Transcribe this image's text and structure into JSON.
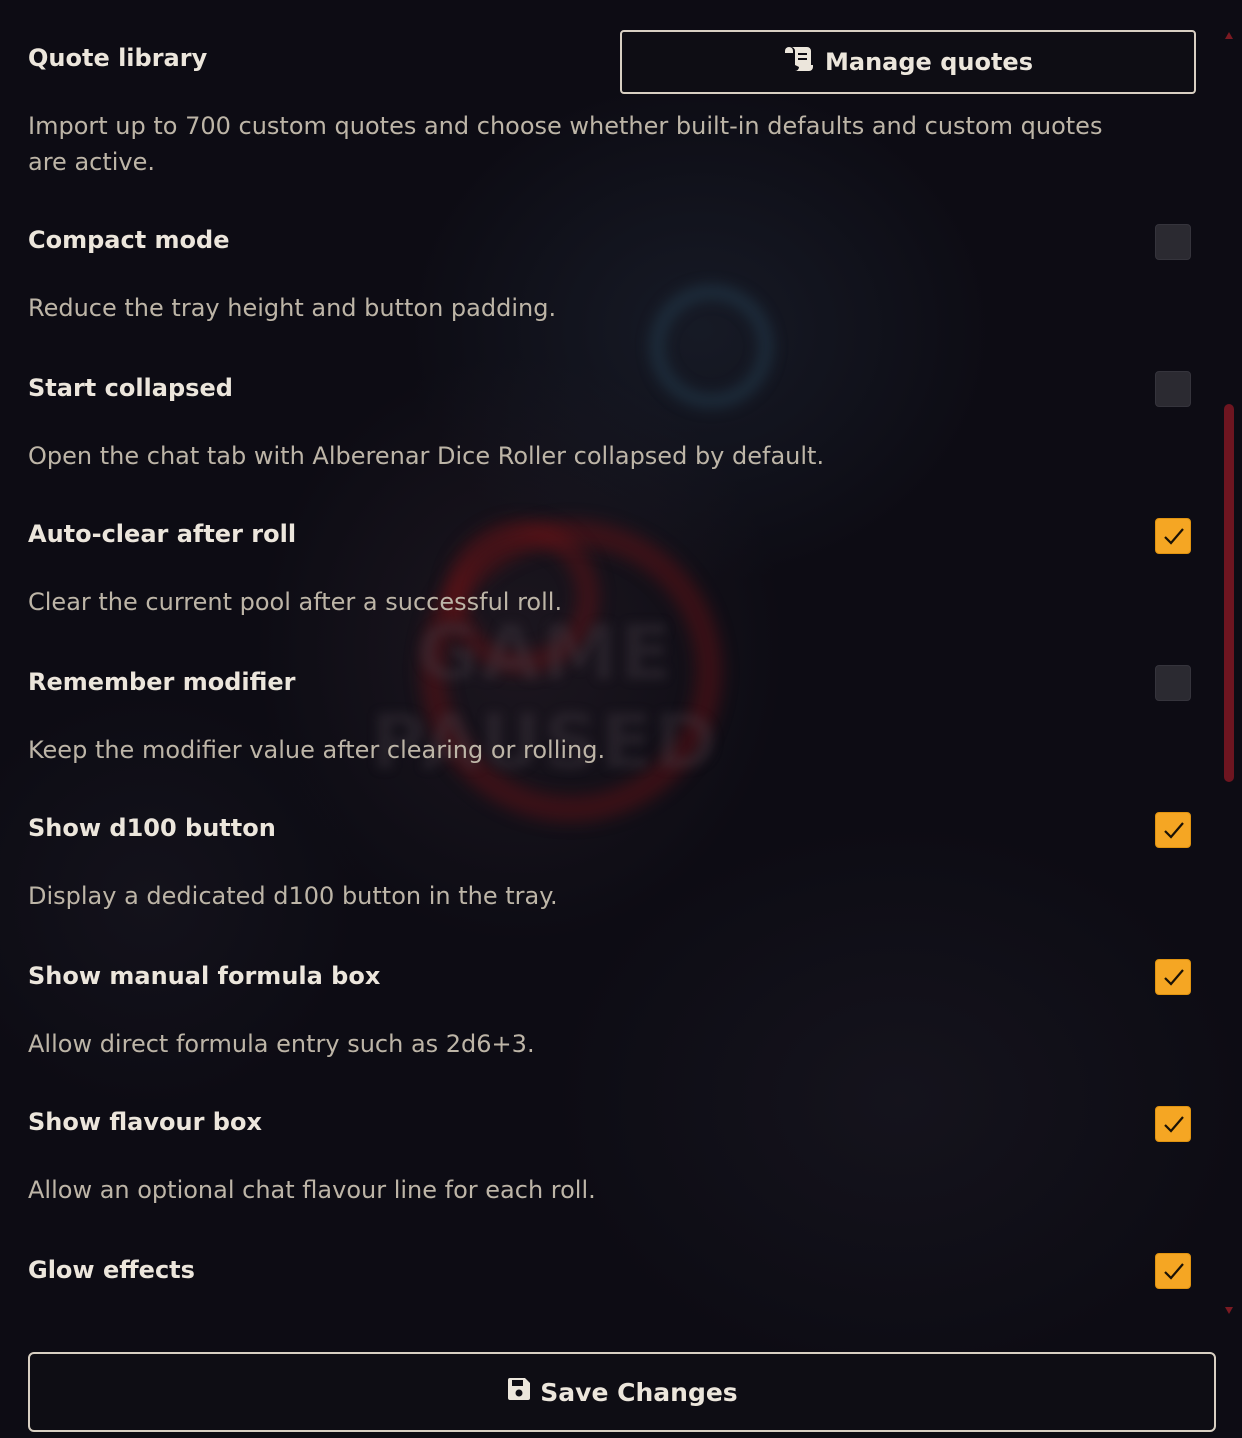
{
  "quote_library": {
    "label": "Quote library",
    "button_label": "Manage quotes",
    "button_icon": "scroll-icon",
    "hint": "Import up to 700 custom quotes and choose whether built-in defaults and custom quotes are active."
  },
  "settings": [
    {
      "label": "Compact mode",
      "hint": "Reduce the tray height and button padding.",
      "checked": false
    },
    {
      "label": "Start collapsed",
      "hint": "Open the chat tab with Alberenar Dice Roller collapsed by default.",
      "checked": false
    },
    {
      "label": "Auto-clear after roll",
      "hint": "Clear the current pool after a successful roll.",
      "checked": true
    },
    {
      "label": "Remember modifier",
      "hint": "Keep the modifier value after clearing or rolling.",
      "checked": false
    },
    {
      "label": "Show d100 button",
      "hint": "Display a dedicated d100 button in the tray.",
      "checked": true
    },
    {
      "label": "Show manual formula box",
      "hint": "Allow direct formula entry such as 2d6+3.",
      "checked": true
    },
    {
      "label": "Show flavour box",
      "hint": "Allow an optional chat flavour line for each roll.",
      "checked": true
    },
    {
      "label": "Glow effects",
      "hint": "",
      "checked": true
    }
  ],
  "background_text": "GAME PAUSED",
  "footer": {
    "save_label": "Save Changes",
    "save_icon": "floppy-disk-icon"
  },
  "colors": {
    "checkbox_on": "#f5a623",
    "checkbox_off": "#2b2a31",
    "scrollbar": "#6e1520",
    "text": "#ece6dc",
    "hint_text": "#bdb5a7"
  }
}
